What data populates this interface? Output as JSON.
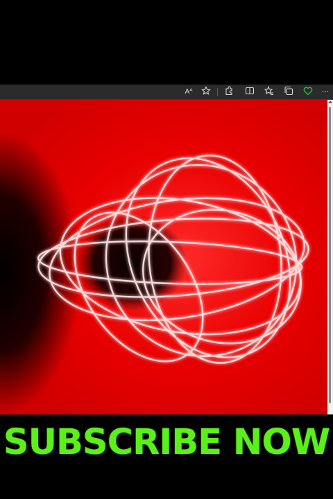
{
  "toolbar": {
    "read_aloud_label": "Aᴬ",
    "icons": [
      "read-aloud-icon",
      "favorite-star-icon",
      "extensions-icon",
      "split-screen-icon",
      "favorites-icon",
      "collections-icon",
      "browser-essentials-icon",
      "more-menu-icon"
    ],
    "accent_green": "#3cc23c"
  },
  "artwork": {
    "background": "#e30000",
    "glow": "#ff1a1a"
  },
  "cta": {
    "text": "SUBSCRIBE NOW",
    "color": "#5cf01a"
  }
}
